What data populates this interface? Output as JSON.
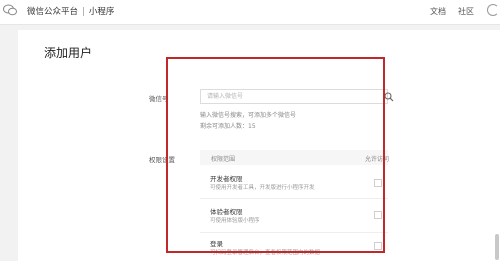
{
  "header": {
    "brand": "微信公众平台",
    "separator": "|",
    "product": "小程序",
    "nav": [
      "文档",
      "社区"
    ]
  },
  "page": {
    "title": "添加用户"
  },
  "form": {
    "wechat_label": "微信号",
    "search_placeholder": "请输入微信号",
    "hint1": "输入微信号搜索，可添加多个微信号",
    "hint2": "剩余可添加人数：15",
    "perm_label": "权限设置",
    "perm_head_col1": "权限范围",
    "perm_head_col2": "允许访问"
  },
  "permissions": [
    {
      "title": "开发者权限",
      "desc": "可使用开发者工具，开发版进行小程序开发"
    },
    {
      "title": "体验者权限",
      "desc": "可使用体验版小程序"
    },
    {
      "title": "登录",
      "desc": "可扫码登录管理后台，查看权限范围内的数据"
    }
  ],
  "colors": {
    "highlight": "#c0282a"
  }
}
